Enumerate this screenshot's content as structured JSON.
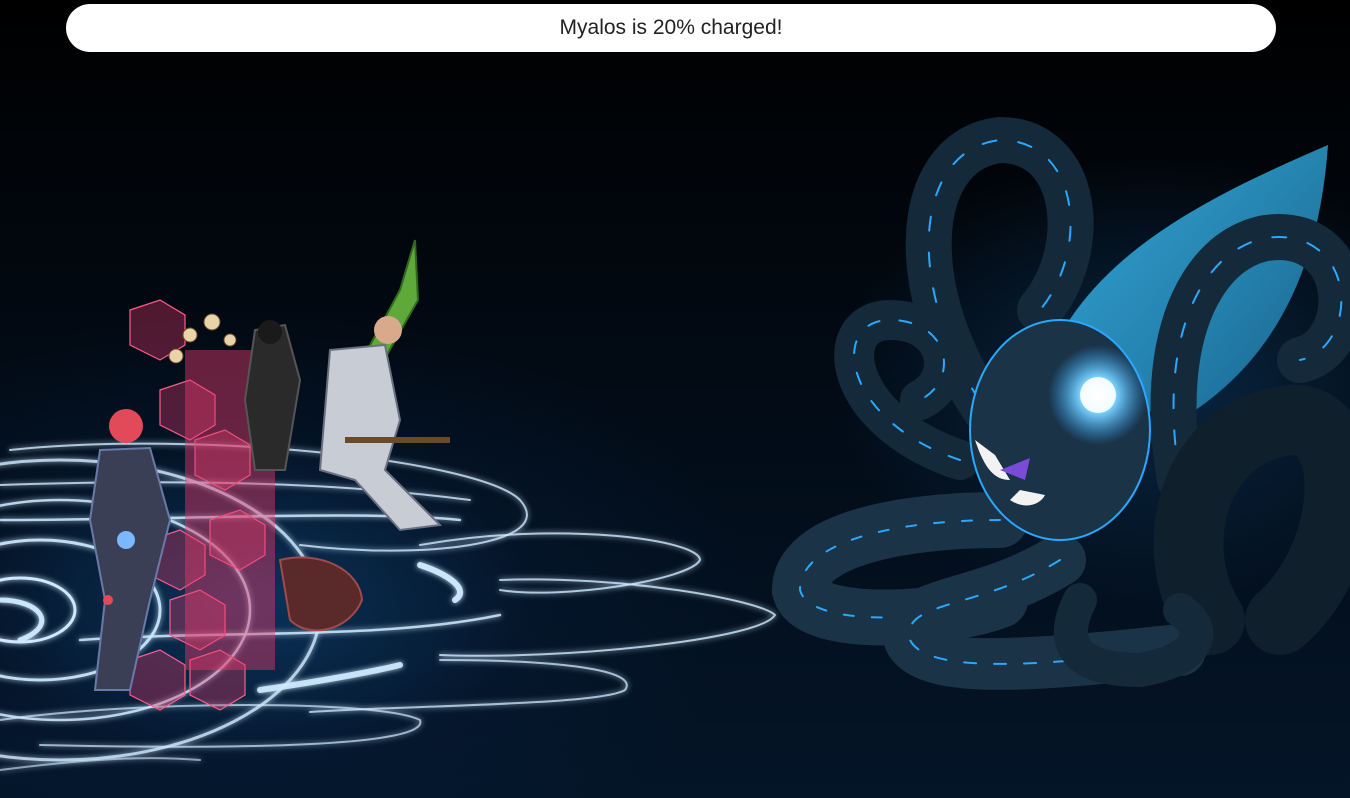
{
  "battle": {
    "status_message": "Myalos is 20% charged!",
    "enemy_charge_percent": 20
  },
  "scene": {
    "party": [
      "cyborg-hero",
      "skull-mage",
      "ninja-hero",
      "armored-knight",
      "beast-pet"
    ],
    "enemy": "giant-kraken",
    "colors": {
      "background": "#000000",
      "glow": "#2aa8ff",
      "kraken_body": "#1b3347",
      "shield": "#e23a6a"
    }
  }
}
